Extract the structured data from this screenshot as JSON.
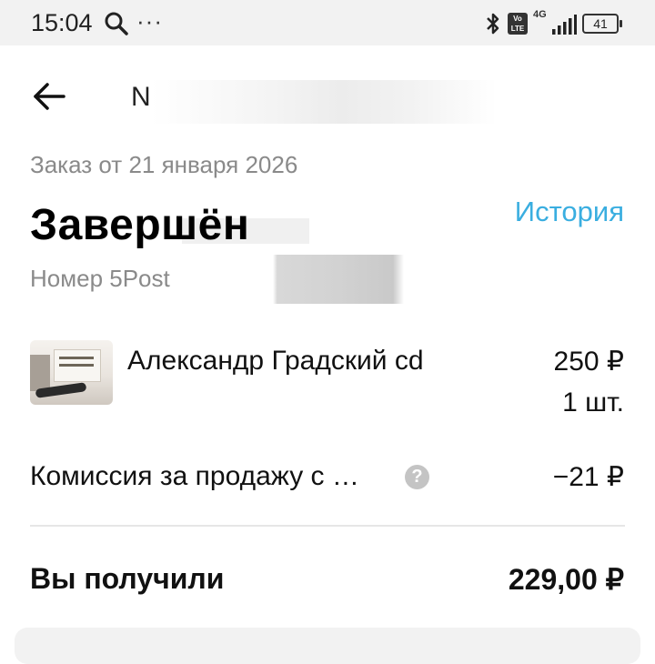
{
  "status_bar": {
    "time": "15:04",
    "dots": "···",
    "volte_top": "Vo",
    "volte_bottom": "LTE",
    "network": "4G",
    "battery": "41"
  },
  "header": {
    "title_visible": "N"
  },
  "order": {
    "date": "Заказ от 21 января 2026",
    "status": "Завершён",
    "history_label": "История",
    "tracking_label": "Номер 5Post"
  },
  "item": {
    "name": "Александр Градский cd",
    "price": "250 ₽",
    "quantity": "1 шт."
  },
  "commission": {
    "label": "Комиссия за продажу с …",
    "help": "?",
    "value": "−21 ₽"
  },
  "total": {
    "label": "Вы получили",
    "value": "229,00 ₽"
  },
  "colors": {
    "accent": "#3aaee0",
    "muted_text": "#8a8a8a",
    "status_bar_bg": "#f2f2f2"
  }
}
